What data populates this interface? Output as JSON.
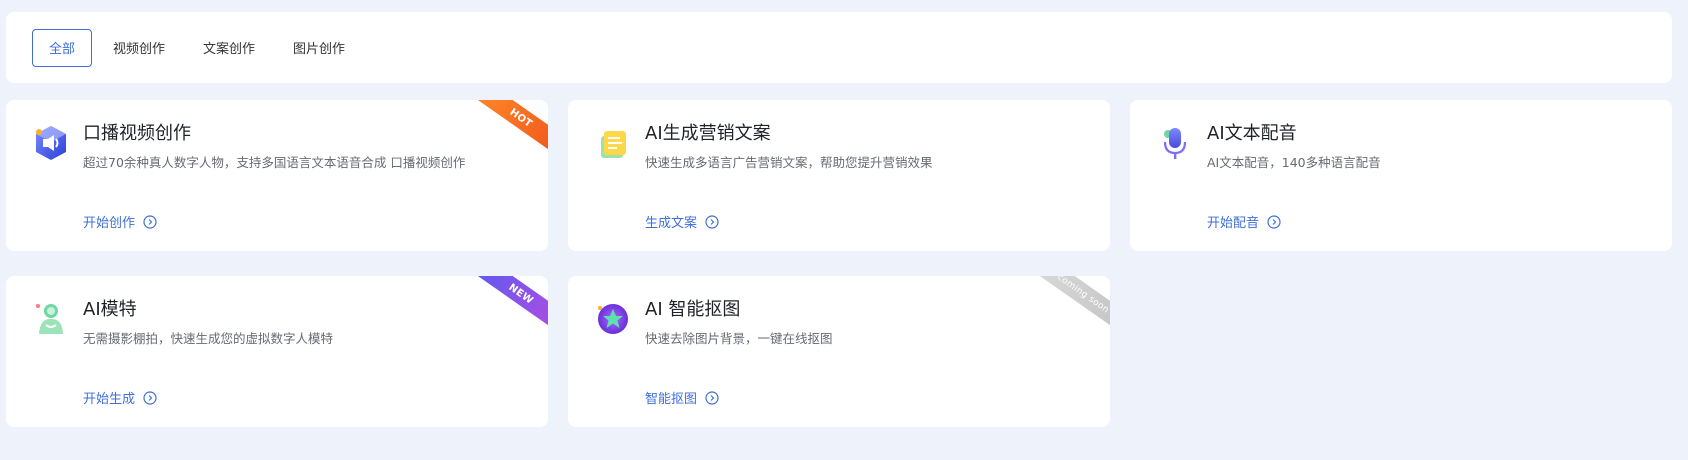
{
  "tabs": [
    {
      "label": "全部",
      "active": true
    },
    {
      "label": "视频创作",
      "active": false
    },
    {
      "label": "文案创作",
      "active": false
    },
    {
      "label": "图片创作",
      "active": false
    }
  ],
  "cards": [
    {
      "title": "口播视频创作",
      "desc": "超过70余种真人数字人物，支持多国语言文本语音合成 口播视频创作",
      "action": "开始创作",
      "badge": "HOT",
      "icon": "speaker-cube-icon"
    },
    {
      "title": "AI生成营销文案",
      "desc": "快速生成多语言广告营销文案，帮助您提升营销效果",
      "action": "生成文案",
      "badge": "",
      "icon": "document-pages-icon"
    },
    {
      "title": "AI文本配音",
      "desc": "AI文本配音，140多种语言配音",
      "action": "开始配音",
      "badge": "",
      "icon": "microphone-icon"
    },
    {
      "title": "AI模特",
      "desc": "无需摄影棚拍，快速生成您的虚拟数字人模特",
      "action": "开始生成",
      "badge": "NEW",
      "icon": "model-figure-icon"
    },
    {
      "title": "AI 智能抠图",
      "desc": "快速去除图片背景，一键在线抠图",
      "action": "智能抠图",
      "badge": "coming soon",
      "icon": "cutout-star-icon"
    }
  ],
  "colors": {
    "accent": "#3f6fd6",
    "background": "#eef3fb",
    "hot": "#f0541a",
    "new": "#8a4fe6"
  }
}
